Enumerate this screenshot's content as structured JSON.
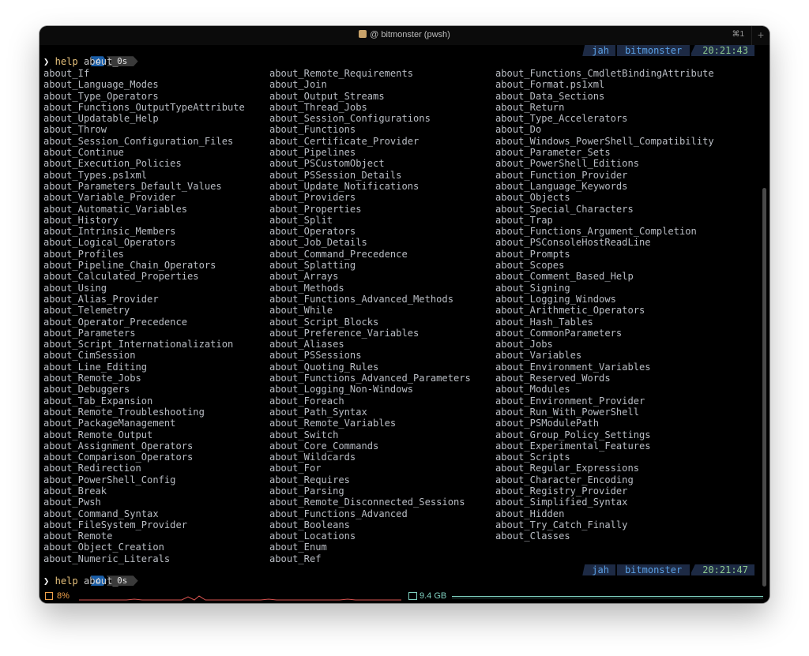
{
  "window": {
    "title": "@ bitmonster (pwsh)",
    "shortcut": "⌘1",
    "new_tab_label": "+"
  },
  "prompt": {
    "apple": "",
    "home_icon": "home-icon",
    "duration": "0s",
    "user": "jah",
    "host": "bitmonster",
    "time_1": "20:21:43",
    "time_2": "20:21:47",
    "prompt_char": "❯",
    "command": "help",
    "arg": "about_"
  },
  "output": {
    "col1": [
      "about_If",
      "about_Language_Modes",
      "about_Type_Operators",
      "about_Functions_OutputTypeAttribute",
      "about_Updatable_Help",
      "about_Throw",
      "about_Session_Configuration_Files",
      "about_Continue",
      "about_Execution_Policies",
      "about_Types.ps1xml",
      "about_Parameters_Default_Values",
      "about_Variable_Provider",
      "about_Automatic_Variables",
      "about_History",
      "about_Intrinsic_Members",
      "about_Logical_Operators",
      "about_Profiles",
      "about_Pipeline_Chain_Operators",
      "about_Calculated_Properties",
      "about_Using",
      "about_Alias_Provider",
      "about_Telemetry",
      "about_Operator_Precedence",
      "about_Parameters",
      "about_Script_Internationalization",
      "about_CimSession",
      "about_Line_Editing",
      "about_Remote_Jobs",
      "about_Debuggers",
      "about_Tab_Expansion",
      "about_Remote_Troubleshooting",
      "about_PackageManagement",
      "about_Remote_Output",
      "about_Assignment_Operators",
      "about_Comparison_Operators",
      "about_Redirection",
      "about_PowerShell_Config",
      "about_Break",
      "about_Pwsh",
      "about_Command_Syntax",
      "about_FileSystem_Provider",
      "about_Remote",
      "about_Object_Creation",
      "about_Numeric_Literals"
    ],
    "col2": [
      "about_Remote_Requirements",
      "about_Join",
      "about_Output_Streams",
      "about_Thread_Jobs",
      "about_Session_Configurations",
      "about_Functions",
      "about_Certificate_Provider",
      "about_Pipelines",
      "about_PSCustomObject",
      "about_PSSession_Details",
      "about_Update_Notifications",
      "about_Providers",
      "about_Properties",
      "about_Split",
      "about_Operators",
      "about_Job_Details",
      "about_Command_Precedence",
      "about_Splatting",
      "about_Arrays",
      "about_Methods",
      "about_Functions_Advanced_Methods",
      "about_While",
      "about_Script_Blocks",
      "about_Preference_Variables",
      "about_Aliases",
      "about_PSSessions",
      "about_Quoting_Rules",
      "about_Functions_Advanced_Parameters",
      "about_Logging_Non-Windows",
      "about_Foreach",
      "about_Path_Syntax",
      "about_Remote_Variables",
      "about_Switch",
      "about_Core_Commands",
      "about_Wildcards",
      "about_For",
      "about_Requires",
      "about_Parsing",
      "about_Remote_Disconnected_Sessions",
      "about_Functions_Advanced",
      "about_Booleans",
      "about_Locations",
      "about_Enum",
      "about_Ref"
    ],
    "col3": [
      "about_Functions_CmdletBindingAttribute",
      "about_Format.ps1xml",
      "about_Data_Sections",
      "about_Return",
      "about_Type_Accelerators",
      "about_Do",
      "about_Windows_PowerShell_Compatibility",
      "about_Parameter_Sets",
      "about_PowerShell_Editions",
      "about_Function_Provider",
      "about_Language_Keywords",
      "about_Objects",
      "about_Special_Characters",
      "about_Trap",
      "about_Functions_Argument_Completion",
      "about_PSConsoleHostReadLine",
      "about_Prompts",
      "about_Scopes",
      "about_Comment_Based_Help",
      "about_Signing",
      "about_Logging_Windows",
      "about_Arithmetic_Operators",
      "about_Hash_Tables",
      "about_CommonParameters",
      "about_Jobs",
      "about_Variables",
      "about_Environment_Variables",
      "about_Reserved_Words",
      "about_Modules",
      "about_Environment_Provider",
      "about_Run_With_PowerShell",
      "about_PSModulePath",
      "about_Group_Policy_Settings",
      "about_Experimental_Features",
      "about_Scripts",
      "about_Regular_Expressions",
      "about_Character_Encoding",
      "about_Registry_Provider",
      "about_Simplified_Syntax",
      "about_Hidden",
      "about_Try_Catch_Finally",
      "about_Classes"
    ]
  },
  "status": {
    "cpu": "8%",
    "memory": "9.4 GB"
  },
  "colors": {
    "cpu": "#f0a14b",
    "memory": "#7fd0c0",
    "home": "#1a5ea8",
    "command": "#e5c07b"
  }
}
